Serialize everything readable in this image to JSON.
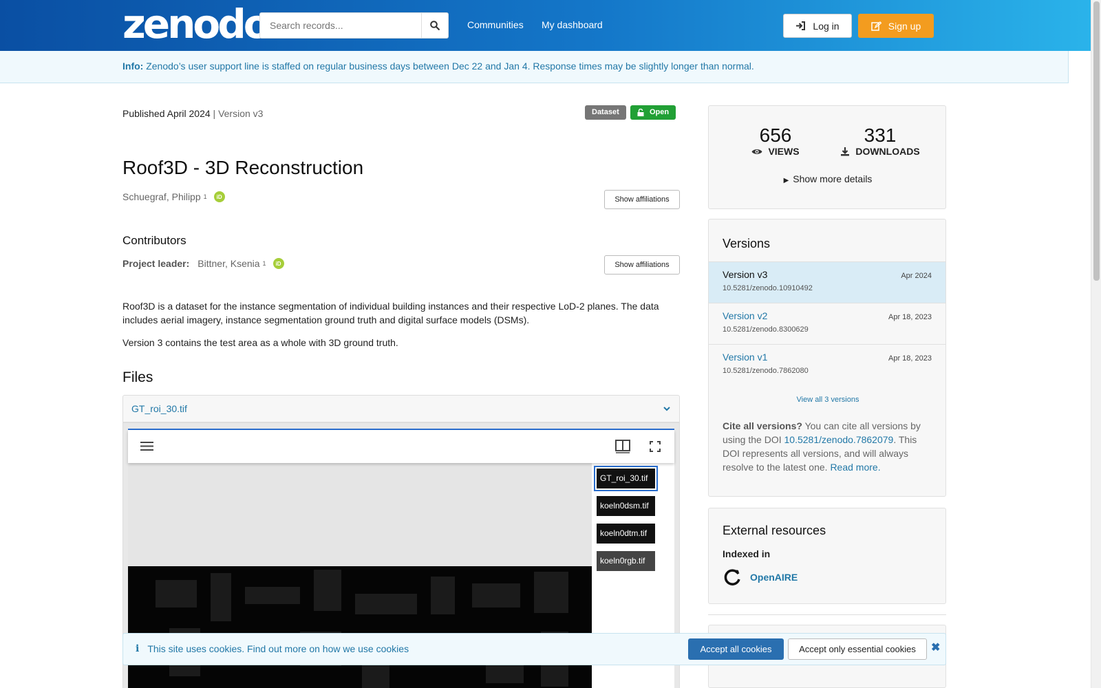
{
  "header": {
    "logo": "zenodo",
    "search_placeholder": "Search records...",
    "nav": [
      "Communities",
      "My dashboard"
    ],
    "login": "Log in",
    "signup": "Sign up"
  },
  "info_banner": {
    "label": "Info:",
    "text": "Zenodo’s user support line is staffed on regular business days between Dec 22 and Jan 4. Response times may be slightly longer than normal."
  },
  "record": {
    "published": "Published April 2024",
    "separator": "|",
    "version": "Version v3",
    "badge_type": "Dataset",
    "badge_access": "Open",
    "title": "Roof3D - 3D Reconstruction",
    "author": "Schuegraf, Philipp",
    "author_sup": "1",
    "show_affiliations": "Show affiliations",
    "contributors_heading": "Contributors",
    "contributor_role": "Project leader:",
    "contributor_name": "Bittner, Ksenia",
    "contributor_sup": "1",
    "description": [
      "Roof3D is a dataset for the instance segmentation of individual building instances and their respective LoD-2 planes. The data includes aerial imagery, instance segmentation ground truth and digital surface models (DSMs).",
      "Version 3 contains the test area as a whole with 3D ground truth."
    ],
    "files_heading": "Files",
    "file_selected": "GT_roi_30.tif",
    "thumbnails": [
      "GT_roi_30.tif",
      "koeln0dsm.tif",
      "koeln0dtm.tif",
      "koeln0rgb.tif"
    ]
  },
  "stats": {
    "views": "656",
    "views_label": "VIEWS",
    "downloads": "331",
    "downloads_label": "DOWNLOADS",
    "show_more": "Show more details"
  },
  "versions": {
    "heading": "Versions",
    "items": [
      {
        "name": "Version v3",
        "date": "Apr 2024",
        "doi": "10.5281/zenodo.10910492"
      },
      {
        "name": "Version v2",
        "date": "Apr 18, 2023",
        "doi": "10.5281/zenodo.8300629"
      },
      {
        "name": "Version v1",
        "date": "Apr 18, 2023",
        "doi": "10.5281/zenodo.7862080"
      }
    ],
    "view_all": "View all 3 versions",
    "cite_bold": "Cite all versions?",
    "cite_text1": " You can cite all versions by using the DOI ",
    "cite_doi": "10.5281/zenodo.7862079",
    "cite_text2": ". This DOI represents all versions, and will always resolve to the latest one. ",
    "cite_readmore": "Read more."
  },
  "external": {
    "heading": "External resources",
    "indexed_in": "Indexed in",
    "openaire": "OpenAIRE"
  },
  "cookie": {
    "text": "This site uses cookies. Find out more on ",
    "link": "how we use cookies",
    "accept_all": "Accept all cookies",
    "accept_essential": "Accept only essential cookies"
  },
  "colors": {
    "brand_blue": "#0a4fa3",
    "accent_orange": "#f39c1f",
    "link": "#2278a7",
    "open_green": "#21a035"
  }
}
